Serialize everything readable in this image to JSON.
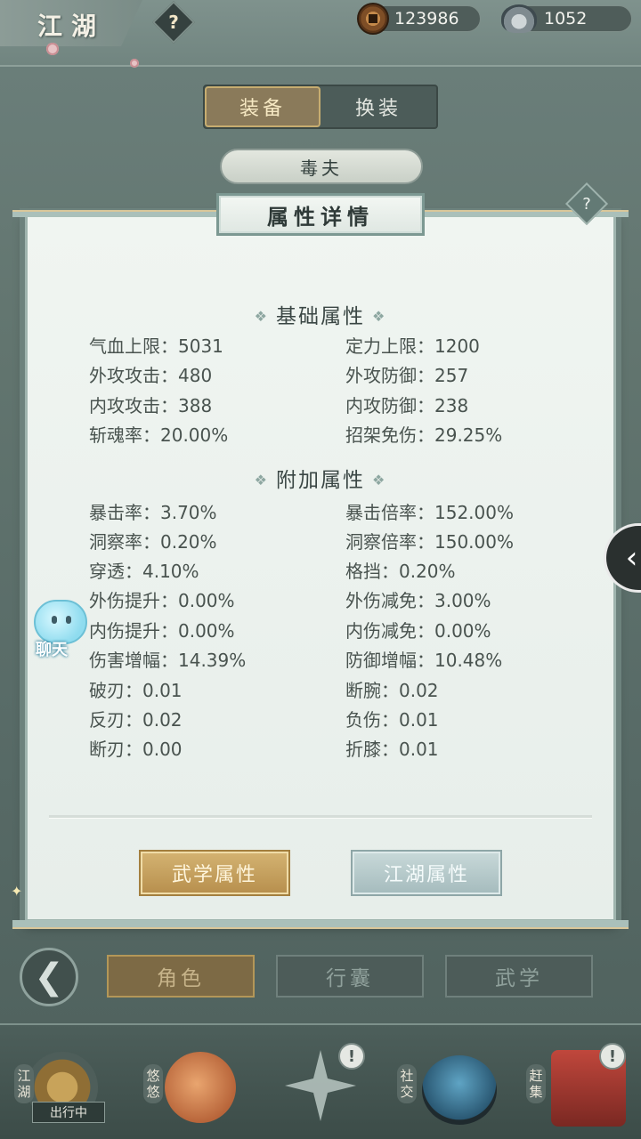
{
  "top_bar": {
    "title": "江湖",
    "help_icon": "?",
    "copper_coins": "123986",
    "silver_ingots": "1052"
  },
  "tabs": [
    {
      "label": "装备",
      "active": true
    },
    {
      "label": "换装",
      "active": false
    }
  ],
  "character_name": "毒夫",
  "panel": {
    "title": "属性详情",
    "help_icon": "?",
    "basic_section_title": "基础属性",
    "basic_stats": [
      {
        "left": "气血上限：5031",
        "right": "定力上限：1200"
      },
      {
        "left": "外攻攻击：480",
        "right": "外攻防御：257"
      },
      {
        "left": "内攻攻击：388",
        "right": "内攻防御：238"
      },
      {
        "left": "斩魂率：20.00%",
        "right": "招架免伤：29.25%"
      }
    ],
    "extra_section_title": "附加属性",
    "extra_stats": [
      {
        "left": "暴击率：3.70%",
        "right": "暴击倍率：152.00%"
      },
      {
        "left": "洞察率：0.20%",
        "right": "洞察倍率：150.00%"
      },
      {
        "left": "穿透：4.10%",
        "right": "格挡：0.20%"
      },
      {
        "left": "外伤提升：0.00%",
        "right": "外伤减免：3.00%"
      },
      {
        "left": "内伤提升：0.00%",
        "right": "内伤减免：0.00%"
      },
      {
        "left": "伤害增幅：14.39%",
        "right": "防御增幅：10.48%"
      },
      {
        "left": "破刃：0.01",
        "right": "断腕：0.02"
      },
      {
        "left": "反刃：0.02",
        "right": "负伤：0.01"
      },
      {
        "left": "断刃：0.00",
        "right": "折膝：0.01"
      }
    ],
    "buttons": {
      "martial": "武学属性",
      "jianghu": "江湖属性"
    }
  },
  "chat_label": "聊天",
  "nav_tabs": [
    "角色",
    "行囊",
    "武学"
  ],
  "dock": {
    "jianghu": "江湖",
    "outgoing_badge": "出行中",
    "youyou": "悠悠",
    "social": "社交",
    "market": "赶集",
    "alert": "!"
  },
  "colors": {
    "accent_gold": "#c7ad70",
    "panel_bg": "#eef3f0",
    "frame": "#6d827d"
  }
}
